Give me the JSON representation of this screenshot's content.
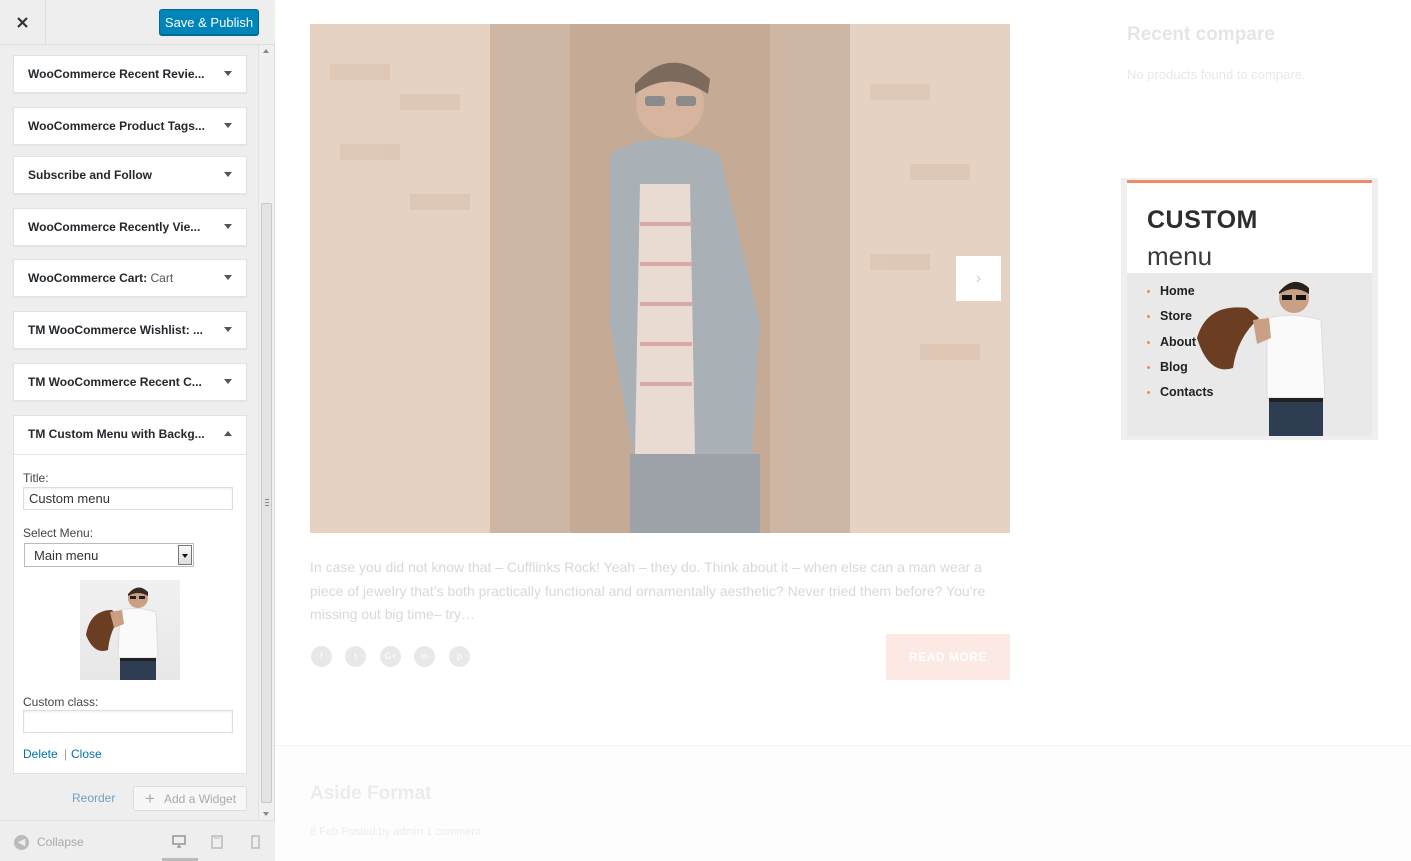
{
  "customizer": {
    "save_button": "Save & Publish",
    "close_icon": "close-icon",
    "widgets": [
      {
        "title": "WooCommerce Recent Revie...",
        "sub": ""
      },
      {
        "title": "WooCommerce Product Tags...",
        "sub": ""
      },
      {
        "title": "Subscribe and Follow",
        "sub": ""
      },
      {
        "title": "WooCommerce Recently Vie...",
        "sub": ""
      },
      {
        "title": "WooCommerce Cart:",
        "sub": "Cart"
      },
      {
        "title": "TM WooCommerce Wishlist: ...",
        "sub": ""
      },
      {
        "title": "TM WooCommerce Recent C...",
        "sub": ""
      }
    ],
    "expanded_widget": {
      "title": "TM Custom Menu with Backg...",
      "title_label": "Title:",
      "title_value": "Custom menu",
      "select_menu_label": "Select Menu:",
      "select_menu_value": "Main menu",
      "custom_class_label": "Custom class:",
      "custom_class_value": "",
      "delete_link": "Delete",
      "separator": "|",
      "close_link": "Close"
    },
    "reorder_link": "Reorder",
    "add_widget_button": "Add a Widget",
    "collapse_label": "Collapse",
    "device_icons": [
      "desktop-icon",
      "tablet-icon",
      "mobile-icon"
    ]
  },
  "preview": {
    "excerpt": "In case you did not know that  – Cufflinks Rock! Yeah – they do. Think about it – when else can a man wear a piece of jewelry that’s both practically functional and ornamentally aesthetic? Never tried them before? You’re missing out big time– try…",
    "social_icons": [
      "f",
      "t",
      "G+",
      "in",
      "p"
    ],
    "read_more": "READ MORE",
    "post2_title": "Aside Format",
    "post2_meta": "8 Feb Posted by admin 1 comment",
    "recent_compare_title": "Recent compare",
    "recent_compare_empty": "No products found to compare.",
    "custom_menu": {
      "title_bold": "CUSTOM",
      "title_light": "menu",
      "items": [
        "Home",
        "Store",
        "About",
        "Blog",
        "Contacts"
      ]
    },
    "accent_color": "#f08a69"
  }
}
